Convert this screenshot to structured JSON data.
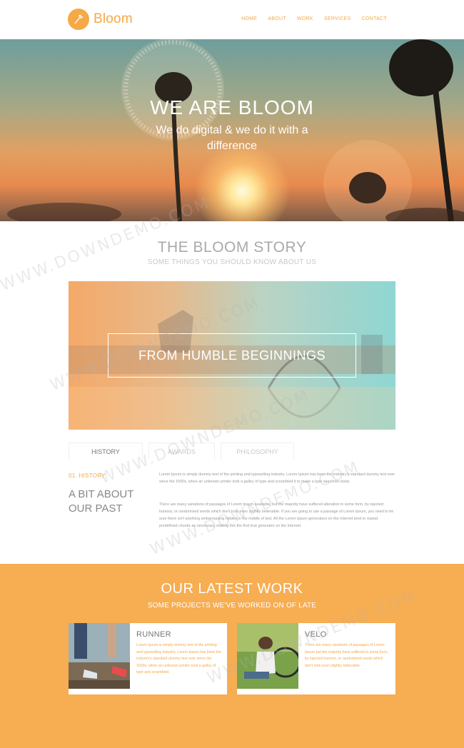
{
  "header": {
    "brand": "Bloom",
    "nav": [
      "HOME",
      "ABOUT",
      "WORK",
      "SERVICES",
      "CONTACT"
    ]
  },
  "hero": {
    "title": "WE ARE BLOOM",
    "subtitle": "We do digital & we do it with a difference"
  },
  "story": {
    "title": "THE BLOOM STORY",
    "subtitle": "SOME THINGS YOU SHOULD KNOW ABOUT US",
    "banner_text": "FROM HUMBLE BEGINNINGS",
    "tabs": [
      "HISTORY",
      "AWARDS",
      "PHILOSOPHY"
    ],
    "active_tab": "HISTORY",
    "section_label": "01. HISTORY",
    "section_title": "A BIT ABOUT OUR PAST",
    "paragraph_1": "Lorem Ipsum is simply dummy text of the printing and typesetting industry. Lorem Ipsum has been the industry's standard dummy text ever since the 1500s, when an unknown printer took a galley of type and scrambled it to make a type specimen book.",
    "paragraph_2": "There are many variations of passages of Lorem Ipsum available, but the majority have suffered alteration in some form, by injected humour, or randomised words which don't look even slightly believable. If you are going to use a passage of Lorem Ipsum, you need to be sure there isn't anything embarrassing hidden in the middle of text. All the Lorem Ipsum generators on the Internet tend to repeat predefined chunks as necessary, making this the first true generator on the Internet."
  },
  "work": {
    "title": "OUR LATEST WORK",
    "subtitle": "SOME PROJECTS WE'VE WORKED ON OF LATE",
    "cards": [
      {
        "title": "RUNNER",
        "text": "Lorem Ipsum is simply dummy text of the printing and typesetting industry. Lorem Ipsum has been the industry's standard dummy text ever since the 1500s, when an unknown printer took a galley of type and scrambled."
      },
      {
        "title": "VELO",
        "text": "There are many variations of passages of Lorem Ipsum but the majority have suffered in some form, by injected humour, or randomised words which don't look even slightly believable."
      }
    ]
  },
  "watermark": "WWW.DOWNDEMO.COM",
  "colors": {
    "accent": "#f5a947",
    "work_bg": "#f7ad52"
  }
}
